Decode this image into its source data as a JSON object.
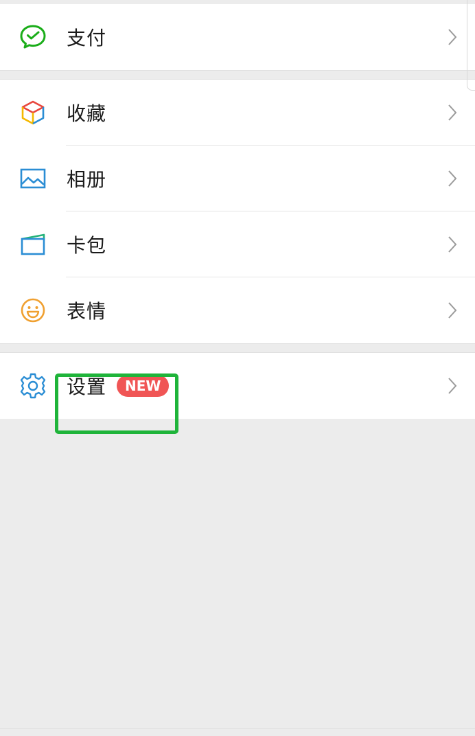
{
  "menu": {
    "items": [
      {
        "label": "支付",
        "icon": "wechat-pay-icon"
      },
      {
        "label": "收藏",
        "icon": "favorites-cube-icon"
      },
      {
        "label": "相册",
        "icon": "photo-album-icon"
      },
      {
        "label": "卡包",
        "icon": "card-wallet-icon"
      },
      {
        "label": "表情",
        "icon": "smiley-icon"
      },
      {
        "label": "设置",
        "icon": "gear-icon",
        "badge": "NEW"
      }
    ]
  },
  "colors": {
    "pay_green": "#1aad19",
    "icon_blue": "#2a8dd4",
    "smiley_orange": "#f0a030",
    "badge_red": "#f05555",
    "highlight_green": "#1fb43a",
    "background": "#ececec"
  }
}
